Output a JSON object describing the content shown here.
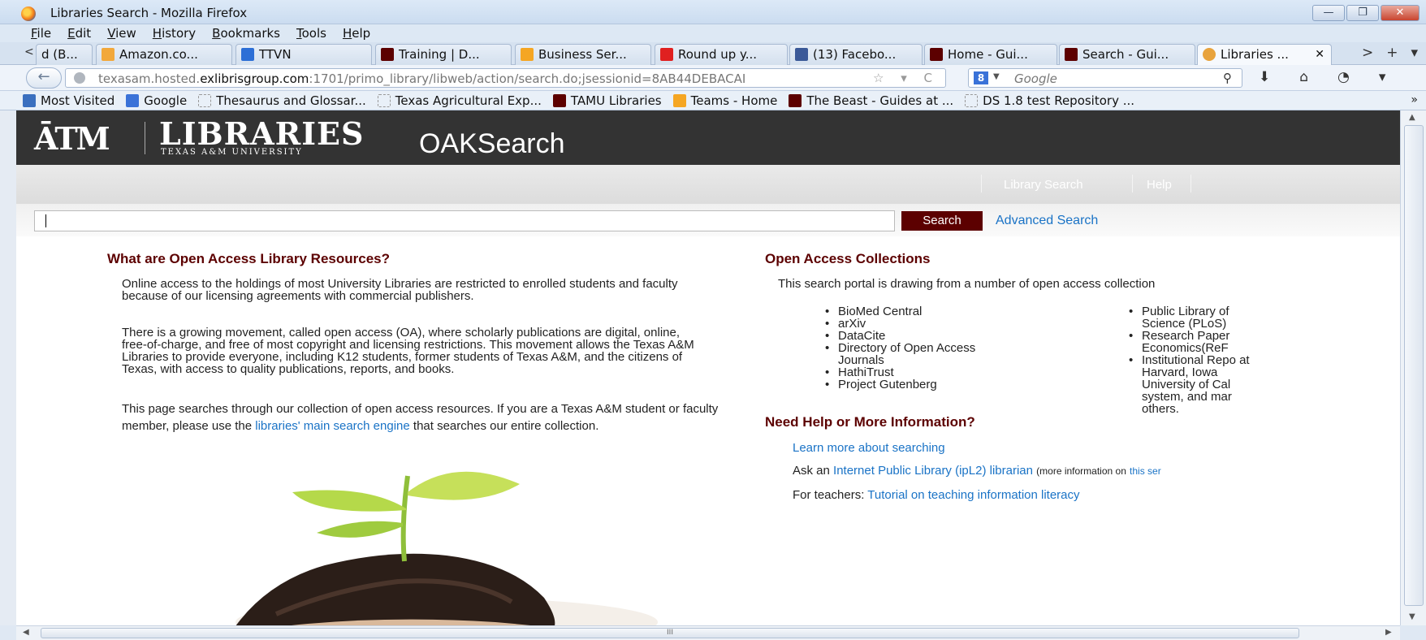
{
  "window": {
    "title": "Libraries Search - Mozilla Firefox",
    "controls": {
      "minimize": "—",
      "maximize": "❐",
      "close": "✕"
    }
  },
  "menu": [
    "File",
    "Edit",
    "View",
    "History",
    "Bookmarks",
    "Tools",
    "Help"
  ],
  "tabs": [
    {
      "label": "d (B...",
      "icon_color": "#cccccc"
    },
    {
      "label": "Amazon.co...",
      "icon_color": "#f2a83b"
    },
    {
      "label": "TTVN",
      "icon_color": "#2d6fd6"
    },
    {
      "label": "Training | D...",
      "icon_color": "#5c0000"
    },
    {
      "label": "Business Ser...",
      "icon_color": "#f5a623"
    },
    {
      "label": "Round up y...",
      "icon_color": "#e02020"
    },
    {
      "label": "(13) Facebo...",
      "icon_color": "#3b5998"
    },
    {
      "label": "Home - Gui...",
      "icon_color": "#5c0000"
    },
    {
      "label": "Search - Gui...",
      "icon_color": "#5c0000"
    },
    {
      "label": "Libraries ...",
      "icon_color": "#e8a33c",
      "active": true
    }
  ],
  "tabstrip_controls": {
    "scroll_left": "<",
    "scroll_right": ">",
    "new_tab": "+",
    "list": "▾"
  },
  "navbar": {
    "back": "←",
    "url_prefix": "texasam.hosted.",
    "url_domain": "exlibrisgroup.com",
    "url_rest": ":1701/primo_library/libweb/action/search.do;jsessionid=8AB44DEBACAI",
    "url_icons": "☆ ▾ C",
    "search_engine_icon": "8",
    "search_placeholder": "Google",
    "right_icons": [
      "⬇",
      "⌂",
      "◔",
      "▾"
    ]
  },
  "bookmarks": [
    {
      "label": "Most Visited",
      "icon": "folder-icon",
      "icon_color": "#3a6fbf"
    },
    {
      "label": "Google",
      "icon": "google-icon",
      "icon_color": "#3a72d8"
    },
    {
      "label": "Thesaurus and Glossar...",
      "icon": "blank-page-icon"
    },
    {
      "label": "Texas Agricultural Exp...",
      "icon": "blank-page-icon"
    },
    {
      "label": "TAMU Libraries",
      "icon": "atm-icon",
      "icon_color": "#5c0000"
    },
    {
      "label": "Teams - Home",
      "icon": "teams-icon",
      "icon_color": "#f5a623"
    },
    {
      "label": "The Beast - Guides at ...",
      "icon": "atm-icon",
      "icon_color": "#5c0000"
    },
    {
      "label": "DS 1.8 test Repository ...",
      "icon": "blank-page-icon"
    }
  ],
  "bookmarks_more": "»",
  "header": {
    "atm": "ĀTM",
    "libraries": "LIBRARIES",
    "university": "TEXAS A&M UNIVERSITY",
    "product": "OAKSearch"
  },
  "subnav": {
    "library_search": "Library Search",
    "help": "Help"
  },
  "search": {
    "button": "Search",
    "advanced": "Advanced Search",
    "value": ""
  },
  "left": {
    "heading": "What are Open Access Library Resources?",
    "p1": "Online access to the holdings of most University Libraries are restricted to enrolled students and faculty because of our licensing agreements with commercial publishers.",
    "p2": "There is a growing movement, called open access (OA), where scholarly publications are digital, online, free-of-charge, and free of most copyright and licensing restrictions. This movement allows the Texas A&M Libraries to provide everyone, including K12 students, former students of Texas A&M, and the citizens of Texas, with access to quality publications, reports, and books.",
    "p3_text": "This page searches through our collection of open access resources. If you are a Texas A&M student or faculty member, please use the",
    "p3_link": "libraries' main search engine",
    "p3_tail": "that searches our entire collection."
  },
  "right": {
    "heading": "Open Access Collections",
    "intro": "This search portal is drawing from a number of open access collection",
    "col1": [
      "BioMed Central",
      "arXiv",
      "DataCite",
      "Directory of Open Access Journals",
      "HathiTrust",
      "Project Gutenberg"
    ],
    "col2": [
      "Public Library of Science (PLoS)",
      "Research Paper Economics(ReF",
      "Institutional Repo at Harvard, Iowa University of Cal system, and mar others."
    ],
    "help_heading": "Need Help or More Information?",
    "learn": "Learn more about searching",
    "ask_prefix": "Ask an",
    "ask_link": "Internet Public Library (ipL2) librarian",
    "ask_small": "(more information on",
    "ask_small_link": "this ser",
    "teachers_prefix": "For teachers:",
    "teachers_link": "Tutorial on teaching information literacy"
  },
  "scroll": {
    "up": "▲",
    "down": "▼",
    "left": "◀",
    "right": "▶",
    "grip": "III"
  }
}
